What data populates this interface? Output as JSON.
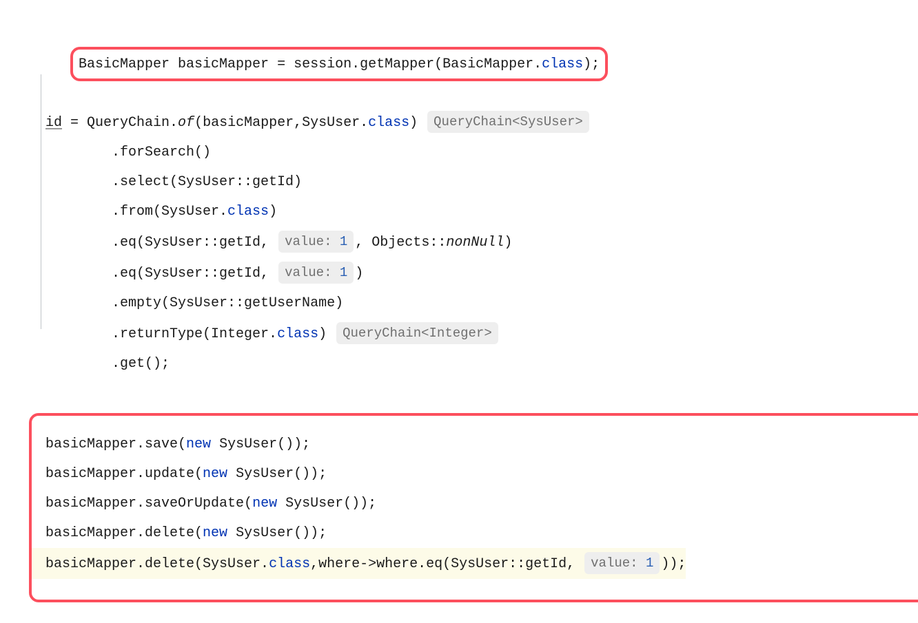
{
  "code": {
    "line1": {
      "t1": "BasicMapper basicMapper = session.getMapper(BasicMapper.",
      "kw": "class",
      "t2": ");"
    },
    "line2": {
      "t1": "id",
      "t2": " = QueryChain.",
      "m": "of",
      "t3": "(basicMapper,SysUser.",
      "kw": "class",
      "t4": ") ",
      "hint": "QueryChain<SysUser>"
    },
    "line3": "        .forSearch()",
    "line4": "        .select(SysUser::getId)",
    "line5": {
      "t1": "        .from(SysUser.",
      "kw": "class",
      "t2": ")"
    },
    "line6": {
      "t1": "        .eq(SysUser::getId, ",
      "hint_label": "value: ",
      "hint_val": "1",
      "t2": ", Objects::",
      "m": "nonNull",
      "t3": ")"
    },
    "line7": {
      "t1": "        .eq(SysUser::getId, ",
      "hint_label": "value: ",
      "hint_val": "1",
      "t2": ")"
    },
    "line8": "        .empty(SysUser::getUserName)",
    "line9": {
      "t1": "        .returnType(Integer.",
      "kw": "class",
      "t2": ") ",
      "hint": "QueryChain<Integer>"
    },
    "line10": "        .get();",
    "block2": {
      "l1": {
        "t1": "basicMapper.save(",
        "kw": "new",
        "t2": " SysUser());"
      },
      "l2": {
        "t1": "basicMapper.update(",
        "kw": "new",
        "t2": " SysUser());"
      },
      "l3": {
        "t1": "basicMapper.saveOrUpdate(",
        "kw": "new",
        "t2": " SysUser());"
      },
      "l4": {
        "t1": "basicMapper.delete(",
        "kw": "new",
        "t2": " SysUser());"
      },
      "l5": {
        "t1": "basicMapper.delete(SysUser.",
        "kw": "class",
        "t2": ",where->where.eq(SysUser::getId, ",
        "hint_label": "value: ",
        "hint_val": "1",
        "t3": "));"
      }
    }
  }
}
